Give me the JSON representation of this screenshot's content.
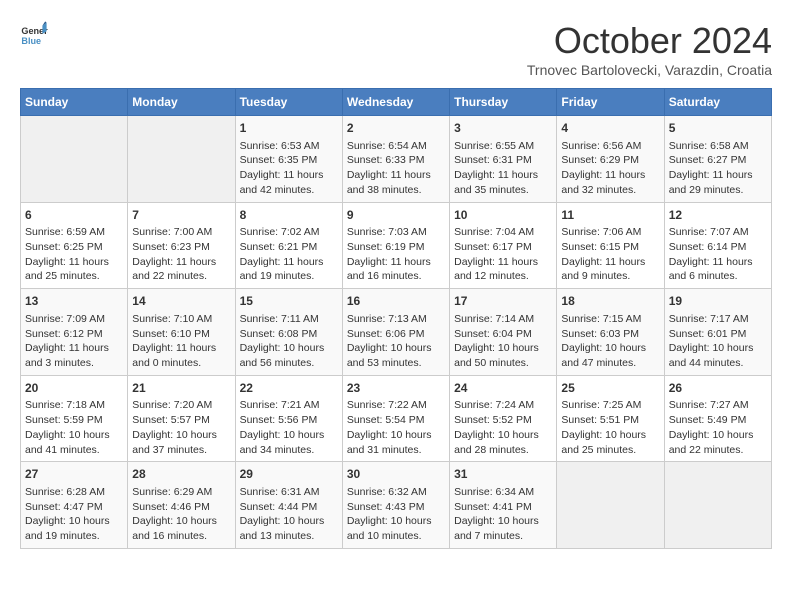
{
  "header": {
    "logo_line1": "General",
    "logo_line2": "Blue",
    "month_title": "October 2024",
    "subtitle": "Trnovec Bartolovecki, Varazdin, Croatia"
  },
  "weekdays": [
    "Sunday",
    "Monday",
    "Tuesday",
    "Wednesday",
    "Thursday",
    "Friday",
    "Saturday"
  ],
  "weeks": [
    [
      {
        "day": "",
        "info": ""
      },
      {
        "day": "",
        "info": ""
      },
      {
        "day": "1",
        "info": "Sunrise: 6:53 AM\nSunset: 6:35 PM\nDaylight: 11 hours and 42 minutes."
      },
      {
        "day": "2",
        "info": "Sunrise: 6:54 AM\nSunset: 6:33 PM\nDaylight: 11 hours and 38 minutes."
      },
      {
        "day": "3",
        "info": "Sunrise: 6:55 AM\nSunset: 6:31 PM\nDaylight: 11 hours and 35 minutes."
      },
      {
        "day": "4",
        "info": "Sunrise: 6:56 AM\nSunset: 6:29 PM\nDaylight: 11 hours and 32 minutes."
      },
      {
        "day": "5",
        "info": "Sunrise: 6:58 AM\nSunset: 6:27 PM\nDaylight: 11 hours and 29 minutes."
      }
    ],
    [
      {
        "day": "6",
        "info": "Sunrise: 6:59 AM\nSunset: 6:25 PM\nDaylight: 11 hours and 25 minutes."
      },
      {
        "day": "7",
        "info": "Sunrise: 7:00 AM\nSunset: 6:23 PM\nDaylight: 11 hours and 22 minutes."
      },
      {
        "day": "8",
        "info": "Sunrise: 7:02 AM\nSunset: 6:21 PM\nDaylight: 11 hours and 19 minutes."
      },
      {
        "day": "9",
        "info": "Sunrise: 7:03 AM\nSunset: 6:19 PM\nDaylight: 11 hours and 16 minutes."
      },
      {
        "day": "10",
        "info": "Sunrise: 7:04 AM\nSunset: 6:17 PM\nDaylight: 11 hours and 12 minutes."
      },
      {
        "day": "11",
        "info": "Sunrise: 7:06 AM\nSunset: 6:15 PM\nDaylight: 11 hours and 9 minutes."
      },
      {
        "day": "12",
        "info": "Sunrise: 7:07 AM\nSunset: 6:14 PM\nDaylight: 11 hours and 6 minutes."
      }
    ],
    [
      {
        "day": "13",
        "info": "Sunrise: 7:09 AM\nSunset: 6:12 PM\nDaylight: 11 hours and 3 minutes."
      },
      {
        "day": "14",
        "info": "Sunrise: 7:10 AM\nSunset: 6:10 PM\nDaylight: 11 hours and 0 minutes."
      },
      {
        "day": "15",
        "info": "Sunrise: 7:11 AM\nSunset: 6:08 PM\nDaylight: 10 hours and 56 minutes."
      },
      {
        "day": "16",
        "info": "Sunrise: 7:13 AM\nSunset: 6:06 PM\nDaylight: 10 hours and 53 minutes."
      },
      {
        "day": "17",
        "info": "Sunrise: 7:14 AM\nSunset: 6:04 PM\nDaylight: 10 hours and 50 minutes."
      },
      {
        "day": "18",
        "info": "Sunrise: 7:15 AM\nSunset: 6:03 PM\nDaylight: 10 hours and 47 minutes."
      },
      {
        "day": "19",
        "info": "Sunrise: 7:17 AM\nSunset: 6:01 PM\nDaylight: 10 hours and 44 minutes."
      }
    ],
    [
      {
        "day": "20",
        "info": "Sunrise: 7:18 AM\nSunset: 5:59 PM\nDaylight: 10 hours and 41 minutes."
      },
      {
        "day": "21",
        "info": "Sunrise: 7:20 AM\nSunset: 5:57 PM\nDaylight: 10 hours and 37 minutes."
      },
      {
        "day": "22",
        "info": "Sunrise: 7:21 AM\nSunset: 5:56 PM\nDaylight: 10 hours and 34 minutes."
      },
      {
        "day": "23",
        "info": "Sunrise: 7:22 AM\nSunset: 5:54 PM\nDaylight: 10 hours and 31 minutes."
      },
      {
        "day": "24",
        "info": "Sunrise: 7:24 AM\nSunset: 5:52 PM\nDaylight: 10 hours and 28 minutes."
      },
      {
        "day": "25",
        "info": "Sunrise: 7:25 AM\nSunset: 5:51 PM\nDaylight: 10 hours and 25 minutes."
      },
      {
        "day": "26",
        "info": "Sunrise: 7:27 AM\nSunset: 5:49 PM\nDaylight: 10 hours and 22 minutes."
      }
    ],
    [
      {
        "day": "27",
        "info": "Sunrise: 6:28 AM\nSunset: 4:47 PM\nDaylight: 10 hours and 19 minutes."
      },
      {
        "day": "28",
        "info": "Sunrise: 6:29 AM\nSunset: 4:46 PM\nDaylight: 10 hours and 16 minutes."
      },
      {
        "day": "29",
        "info": "Sunrise: 6:31 AM\nSunset: 4:44 PM\nDaylight: 10 hours and 13 minutes."
      },
      {
        "day": "30",
        "info": "Sunrise: 6:32 AM\nSunset: 4:43 PM\nDaylight: 10 hours and 10 minutes."
      },
      {
        "day": "31",
        "info": "Sunrise: 6:34 AM\nSunset: 4:41 PM\nDaylight: 10 hours and 7 minutes."
      },
      {
        "day": "",
        "info": ""
      },
      {
        "day": "",
        "info": ""
      }
    ]
  ]
}
